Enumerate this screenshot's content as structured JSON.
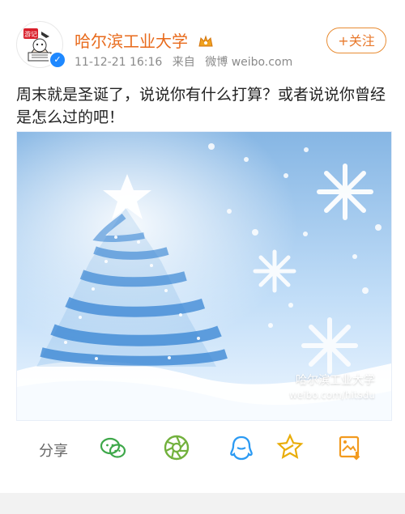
{
  "post": {
    "author_name": "哈尔滨工业大学",
    "time": "11-12-21 16:16",
    "source_prefix": "来自",
    "source": "微博 weibo.com",
    "follow_label": "+关注",
    "text": "周末就是圣诞了，说说你有什么打算？或者说说你曾经是怎么过的吧！"
  },
  "image": {
    "watermark_line1": "哈尔滨工业大学",
    "watermark_line2": "weibo.com/hitsdu"
  },
  "share": {
    "label": "分享"
  },
  "colors": {
    "accent_orange": "#e8782b",
    "verified_blue": "#1e88ff",
    "wechat_green": "#3ea84a",
    "moments_green": "#72b13d",
    "qq_blue": "#2b9af3",
    "qzone_yellow": "#e9ad0a",
    "save_orange": "#f29a1e"
  },
  "icons": [
    "wechat-icon",
    "moments-icon",
    "qq-icon",
    "qzone-icon",
    "save-image-icon"
  ]
}
